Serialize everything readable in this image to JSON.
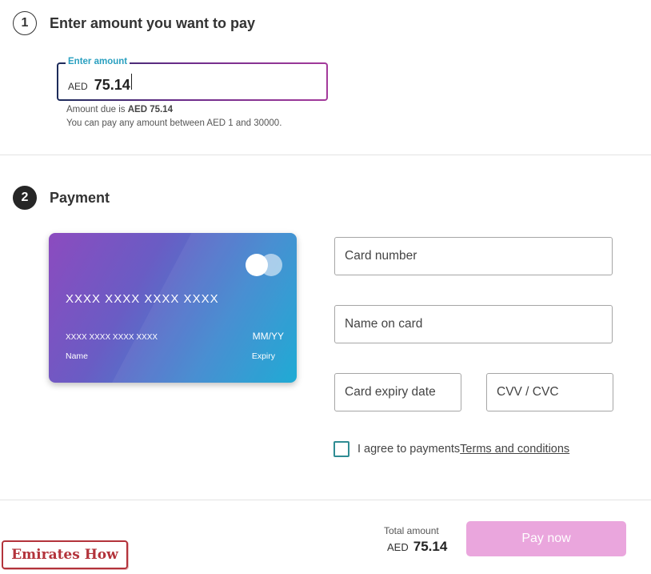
{
  "step1": {
    "number": "1",
    "title": "Enter amount you want to pay",
    "amount_field": {
      "label": "Enter amount",
      "currency": "AED",
      "value": "75.14"
    },
    "amount_due_prefix": "Amount due is ",
    "amount_due_value": "AED 75.14",
    "range_text": "You can pay any amount between AED 1 and 30000."
  },
  "step2": {
    "number": "2",
    "title": "Payment",
    "card_preview": {
      "number": "XXXX XXXX XXXX XXXX",
      "number_small": "XXXX XXXX XXXX XXXX",
      "name_label": "Name",
      "expiry_value": "MM/YY",
      "expiry_label": "Expiry"
    },
    "fields": {
      "card_number_placeholder": "Card number",
      "name_on_card_placeholder": "Name on card",
      "card_expiry_placeholder": "Card expiry date",
      "cvv_placeholder": "CVV / CVC"
    },
    "agree_text": "I agree to payments",
    "terms_link": "Terms and conditions"
  },
  "footer": {
    "total_label": "Total amount",
    "total_currency": "AED",
    "total_value": "75.14",
    "pay_button": "Pay now"
  },
  "watermark": "Emirates How",
  "colors": {
    "accent_label": "#2aa0c0",
    "pay_button": "#eaa6dd",
    "checkbox": "#2f8c93",
    "card_gradient_start": "#8c4bbf",
    "card_gradient_end": "#12a6d2",
    "watermark": "#b3333b"
  }
}
